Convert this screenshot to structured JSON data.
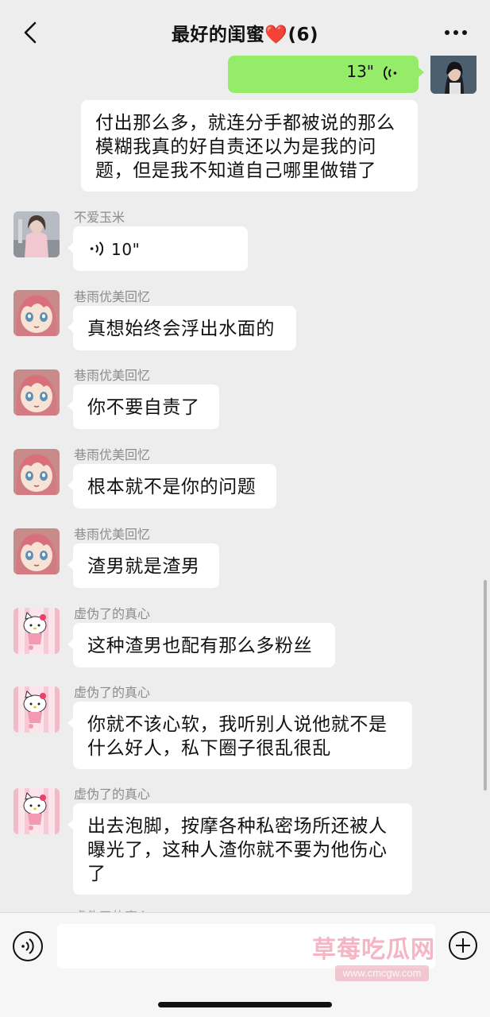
{
  "header": {
    "title": "最好的闺蜜❤️(6)"
  },
  "messages": {
    "m0_duration": "13\"",
    "m1_text": "付出那么多，就连分手都被说的那么模糊我真的好自责还以为是我的问题，但是我不知道自己哪里做错了",
    "m2_sender": "不爱玉米",
    "m2_duration": "10\"",
    "m3_sender": "巷雨优美回忆",
    "m3_text": "真想始终会浮出水面的",
    "m4_sender": "巷雨优美回忆",
    "m4_text": "你不要自责了",
    "m5_sender": "巷雨优美回忆",
    "m5_text": "根本就不是你的问题",
    "m6_sender": "巷雨优美回忆",
    "m6_text": "渣男就是渣男",
    "m7_sender": "虚伪了的真心",
    "m7_text": "这种渣男也配有那么多粉丝",
    "m8_sender": "虚伪了的真心",
    "m8_text": "你就不该心软，我听别人说他就不是什么好人，私下圈子很乱很乱",
    "m9_sender": "虚伪了的真心",
    "m9_text": "出去泡脚，按摩各种私密场所还被人曝光了，这种人渣你就不要为他伤心了",
    "m10_sender_partial": "虚伪了的真心"
  },
  "input": {
    "value": ""
  },
  "watermark": {
    "text": "草莓吃瓜网",
    "url": "www.cmcgw.com"
  },
  "colors": {
    "background": "#ededed",
    "self_bubble": "#95ec69",
    "other_bubble": "#ffffff",
    "sender_name": "#8c8c8c"
  },
  "icons": [
    "back-arrow-icon",
    "more-icon",
    "voice-wave-icon",
    "voice-input-icon",
    "plus-icon"
  ]
}
